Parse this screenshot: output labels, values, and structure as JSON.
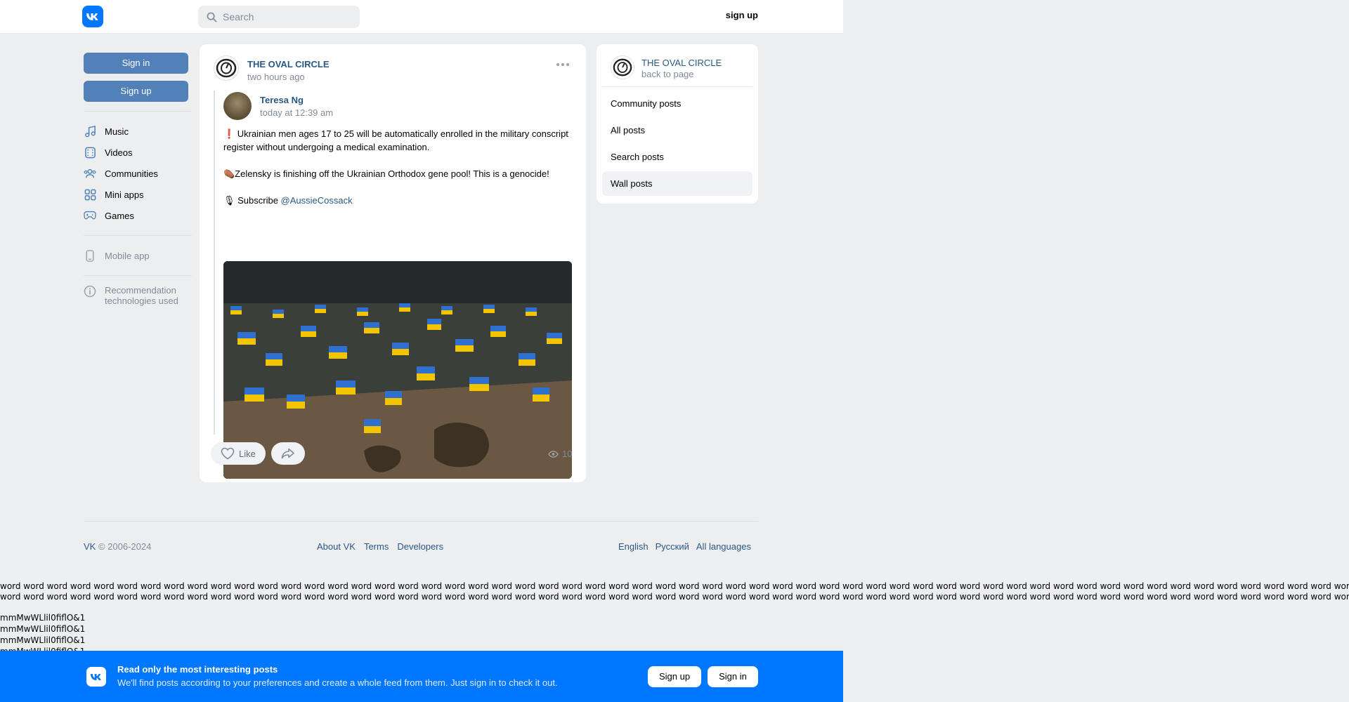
{
  "header": {
    "logo_icon": "vk-logo-icon",
    "search_placeholder": "Search",
    "signup_label": "sign up"
  },
  "sidebar": {
    "signin_label": "Sign in",
    "signup_label": "Sign up",
    "items": [
      {
        "label": "Music",
        "icon": "music-icon"
      },
      {
        "label": "Videos",
        "icon": "video-icon"
      },
      {
        "label": "Communities",
        "icon": "communities-icon"
      },
      {
        "label": "Mini apps",
        "icon": "apps-icon"
      },
      {
        "label": "Games",
        "icon": "gamepad-icon"
      }
    ],
    "mobile_app": "Mobile app",
    "recommendation": "Recommendation technologies used"
  },
  "post": {
    "community": "THE OVAL CIRCLE",
    "time": "two hours ago",
    "repost": {
      "author": "Teresa Ng",
      "time": "today at 12:39 am",
      "text1": "❗ Ukrainian men ages 17 to 25 will be automatically enrolled in the military conscript register without undergoing a medical examination.",
      "text2": "⚰️Zelensky is finishing off the Ukrainian Orthodox gene pool! This is a genocide!",
      "text3_prefix": "🎙 Subscribe ",
      "mention": "@AussieCossack"
    },
    "like_label": "Like",
    "views": "10"
  },
  "right_panel": {
    "community": "THE OVAL CIRCLE",
    "back": "back to page",
    "items": [
      "Community posts",
      "All posts",
      "Search posts",
      "Wall posts"
    ],
    "active": "Wall posts"
  },
  "footer": {
    "vk": "VK",
    "copyright": " © 2006-2024",
    "links": [
      "About VK",
      "Terms",
      "Developers"
    ],
    "languages": [
      "English",
      "Русский",
      "All languages"
    ]
  },
  "filler": {
    "line": "word word word word word word word word word word word word word word word word word word word word word word word word word word word word word word word word word word word word word word word word word word word word word word word word word word word word word word word word word word word word word word word word word word",
    "mmm": "mmMwWLlil0fiflO&1"
  },
  "banner": {
    "title": "Read only the most interesting posts",
    "subtitle": "We'll find posts according to your preferences and create a whole feed from them. Just sign in to check it out.",
    "signup": "Sign up",
    "signin": "Sign in"
  },
  "colors": {
    "vk_blue": "#0077ff",
    "button_blue": "#5181b8",
    "link": "#2a5885",
    "background": "#edeef0"
  }
}
